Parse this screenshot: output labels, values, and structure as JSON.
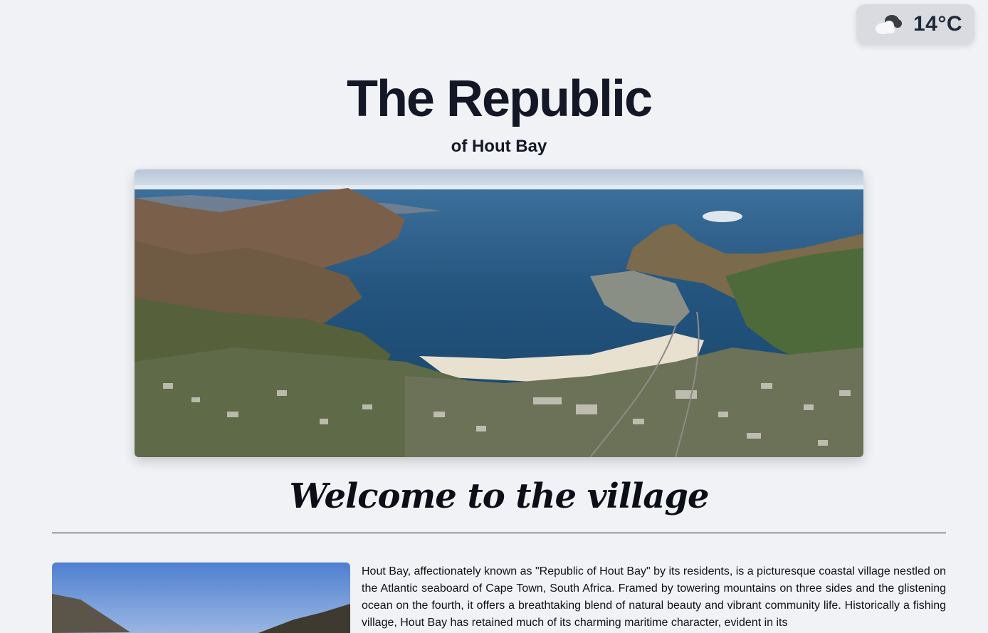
{
  "weather": {
    "icon": "cloudy-icon",
    "temperature": "14°C"
  },
  "header": {
    "title": "The Republic",
    "subtitle": "of Hout Bay"
  },
  "hero": {
    "alt": "Aerial view of Hout Bay"
  },
  "welcome": {
    "heading": "Welcome to the village"
  },
  "intro": {
    "image_alt": "Hout Bay mountains",
    "text": "Hout Bay, affectionately known as \"Republic of Hout Bay\" by its residents, is a picturesque coastal village nestled on the Atlantic seaboard of Cape Town, South Africa. Framed by towering mountains on three sides and the glistening ocean on the fourth, it offers a breathtaking blend of natural beauty and vibrant community life. Historically a fishing village, Hout Bay has retained much of its charming maritime character, evident in its"
  }
}
